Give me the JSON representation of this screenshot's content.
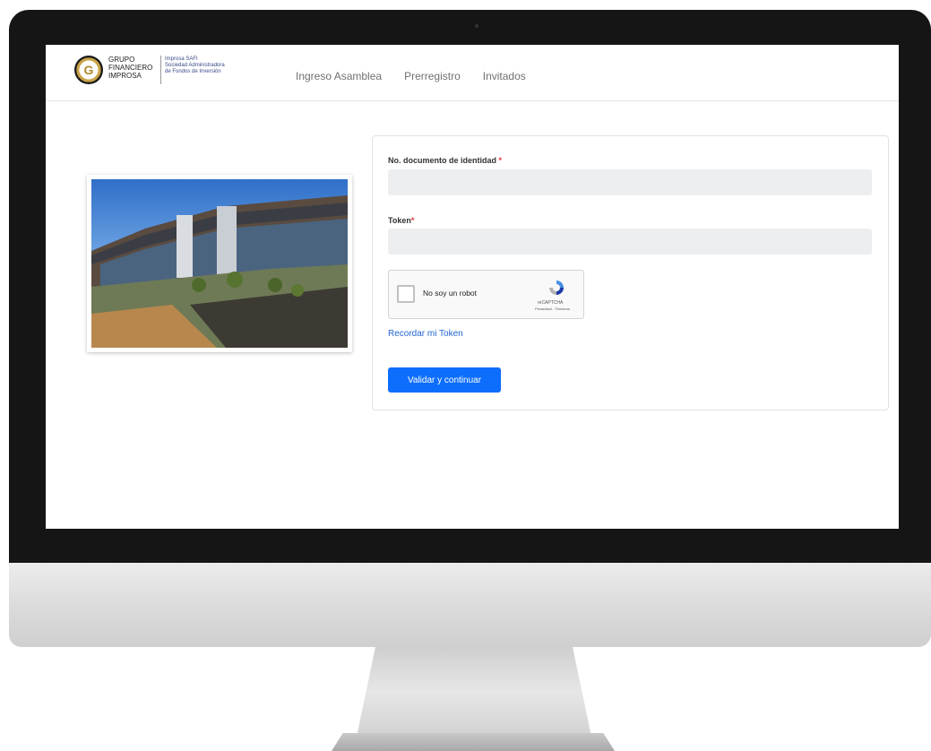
{
  "brand": {
    "group_lines": [
      "GRUPO",
      "FINANCIERO",
      "IMPROSA"
    ],
    "sub_lines": [
      "Improsa SAFI",
      "Sociedad Administradora",
      "de Fondos de Inversión"
    ]
  },
  "nav": {
    "items": [
      {
        "label": "Ingreso Asamblea"
      },
      {
        "label": "Prerregistro"
      },
      {
        "label": "Invitados"
      }
    ]
  },
  "form": {
    "id_label": "No. documento de identidad",
    "token_label": "Token",
    "required_mark": "*",
    "id_value": "",
    "token_value": "",
    "captcha": {
      "label": "No soy un robot",
      "brand": "reCAPTCHA",
      "links": "Privacidad - Términos",
      "checked": false
    },
    "remember_link": "Recordar mi Token",
    "submit_label": "Validar y continuar"
  },
  "colors": {
    "accent": "#0d6efd",
    "link": "#2366d1",
    "required": "#e0303a",
    "gold": "#c9a349"
  },
  "icons": {
    "logo": "improsa-logo-icon",
    "captcha": "recaptcha-icon"
  }
}
